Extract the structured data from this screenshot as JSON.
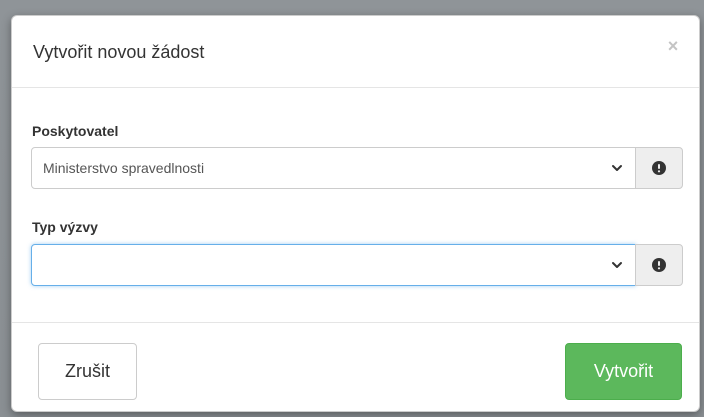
{
  "modal": {
    "title": "Vytvořit novou žádost",
    "close_label": "×"
  },
  "form": {
    "provider": {
      "label": "Poskytovatel",
      "value": "Ministerstvo spravedlnosti",
      "info_icon": "exclamation-circle-icon"
    },
    "call_type": {
      "label": "Typ výzvy",
      "value": "",
      "info_icon": "exclamation-circle-icon"
    }
  },
  "footer": {
    "cancel_label": "Zrušit",
    "create_label": "Vytvořit"
  },
  "colors": {
    "primary_success": "#5cb85c",
    "focus_border": "#66afe9",
    "addon_bg": "#eeeeee"
  }
}
